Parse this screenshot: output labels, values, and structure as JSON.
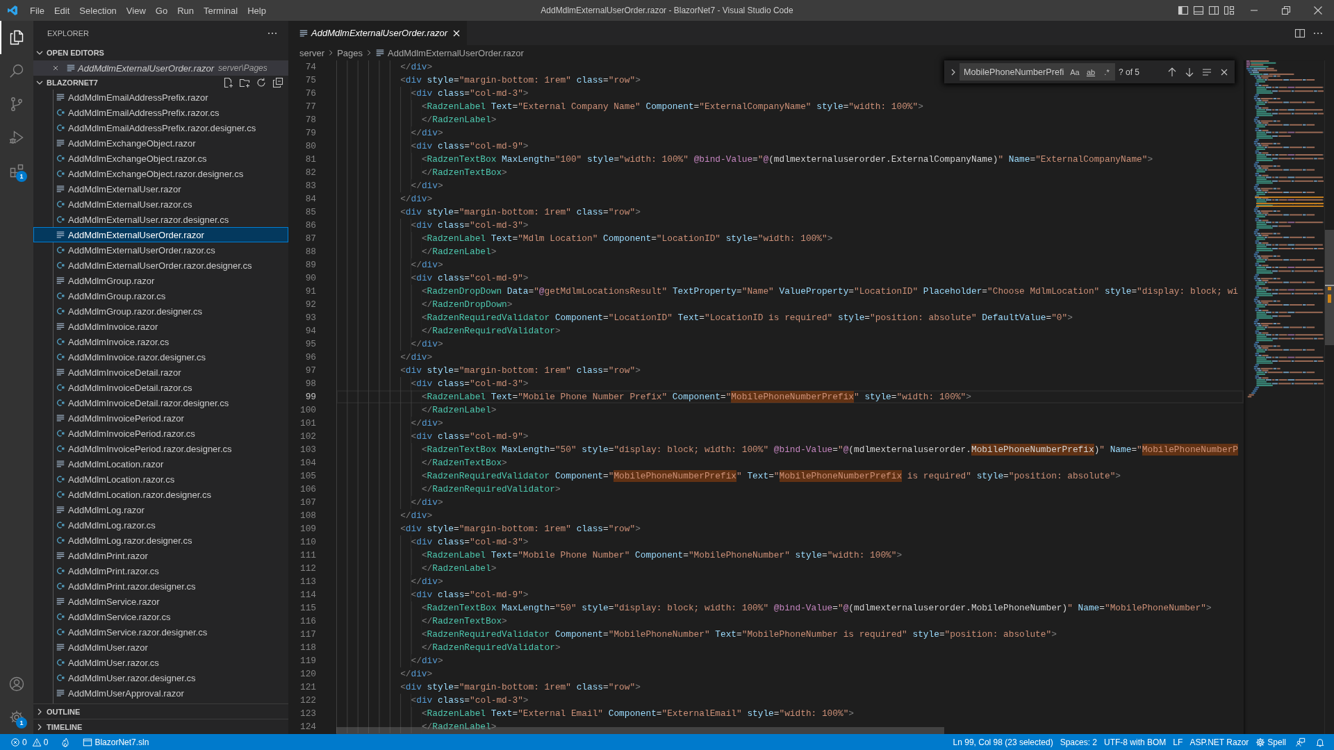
{
  "title_bar": {
    "menus": [
      "File",
      "Edit",
      "Selection",
      "View",
      "Go",
      "Run",
      "Terminal",
      "Help"
    ],
    "title": "AddMdlmExternalUserOrder.razor - BlazorNet7 - Visual Studio Code"
  },
  "activity_bar": {
    "top": [
      {
        "kind": "files",
        "selected": true
      },
      {
        "kind": "search",
        "selected": false
      },
      {
        "kind": "source-control",
        "selected": false
      },
      {
        "kind": "run-debug",
        "selected": false
      },
      {
        "kind": "extensions",
        "selected": false,
        "badge": "1"
      }
    ],
    "bottom": [
      {
        "kind": "account",
        "selected": false
      },
      {
        "kind": "settings",
        "selected": false,
        "badge": "1"
      }
    ]
  },
  "sidebar": {
    "title": "EXPLORER",
    "open_editors": {
      "title": "OPEN EDITORS",
      "expanded": true,
      "items": [
        {
          "name": "AddMdlmExternalUserOrder.razor",
          "description": "server\\Pages",
          "kind": "razor",
          "selected": true,
          "preview": true
        }
      ]
    },
    "folder": {
      "title": "BLAZORNET7",
      "expanded": true,
      "children": [
        {
          "name": "AddMdlmEmailAddressPrefix.razor",
          "kind": "razor",
          "selected": false
        },
        {
          "name": "AddMdlmEmailAddressPrefix.razor.cs",
          "kind": "csharp",
          "selected": false
        },
        {
          "name": "AddMdlmEmailAddressPrefix.razor.designer.cs",
          "kind": "csharp",
          "selected": false
        },
        {
          "name": "AddMdlmExchangeObject.razor",
          "kind": "razor",
          "selected": false
        },
        {
          "name": "AddMdlmExchangeObject.razor.cs",
          "kind": "csharp",
          "selected": false
        },
        {
          "name": "AddMdlmExchangeObject.razor.designer.cs",
          "kind": "csharp",
          "selected": false
        },
        {
          "name": "AddMdlmExternalUser.razor",
          "kind": "razor",
          "selected": false
        },
        {
          "name": "AddMdlmExternalUser.razor.cs",
          "kind": "csharp",
          "selected": false
        },
        {
          "name": "AddMdlmExternalUser.razor.designer.cs",
          "kind": "csharp",
          "selected": false
        },
        {
          "name": "AddMdlmExternalUserOrder.razor",
          "kind": "razor",
          "selected": true
        },
        {
          "name": "AddMdlmExternalUserOrder.razor.cs",
          "kind": "csharp",
          "selected": false
        },
        {
          "name": "AddMdlmExternalUserOrder.razor.designer.cs",
          "kind": "csharp",
          "selected": false
        },
        {
          "name": "AddMdlmGroup.razor",
          "kind": "razor",
          "selected": false
        },
        {
          "name": "AddMdlmGroup.razor.cs",
          "kind": "csharp",
          "selected": false
        },
        {
          "name": "AddMdlmGroup.razor.designer.cs",
          "kind": "csharp",
          "selected": false
        },
        {
          "name": "AddMdlmInvoice.razor",
          "kind": "razor",
          "selected": false
        },
        {
          "name": "AddMdlmInvoice.razor.cs",
          "kind": "csharp",
          "selected": false
        },
        {
          "name": "AddMdlmInvoice.razor.designer.cs",
          "kind": "csharp",
          "selected": false
        },
        {
          "name": "AddMdlmInvoiceDetail.razor",
          "kind": "razor",
          "selected": false
        },
        {
          "name": "AddMdlmInvoiceDetail.razor.cs",
          "kind": "csharp",
          "selected": false
        },
        {
          "name": "AddMdlmInvoiceDetail.razor.designer.cs",
          "kind": "csharp",
          "selected": false
        },
        {
          "name": "AddMdlmInvoicePeriod.razor",
          "kind": "razor",
          "selected": false
        },
        {
          "name": "AddMdlmInvoicePeriod.razor.cs",
          "kind": "csharp",
          "selected": false
        },
        {
          "name": "AddMdlmInvoicePeriod.razor.designer.cs",
          "kind": "csharp",
          "selected": false
        },
        {
          "name": "AddMdlmLocation.razor",
          "kind": "razor",
          "selected": false
        },
        {
          "name": "AddMdlmLocation.razor.cs",
          "kind": "csharp",
          "selected": false
        },
        {
          "name": "AddMdlmLocation.razor.designer.cs",
          "kind": "csharp",
          "selected": false
        },
        {
          "name": "AddMdlmLog.razor",
          "kind": "razor",
          "selected": false
        },
        {
          "name": "AddMdlmLog.razor.cs",
          "kind": "csharp",
          "selected": false
        },
        {
          "name": "AddMdlmLog.razor.designer.cs",
          "kind": "csharp",
          "selected": false
        },
        {
          "name": "AddMdlmPrint.razor",
          "kind": "razor",
          "selected": false
        },
        {
          "name": "AddMdlmPrint.razor.cs",
          "kind": "csharp",
          "selected": false
        },
        {
          "name": "AddMdlmPrint.razor.designer.cs",
          "kind": "csharp",
          "selected": false
        },
        {
          "name": "AddMdlmService.razor",
          "kind": "razor",
          "selected": false
        },
        {
          "name": "AddMdlmService.razor.cs",
          "kind": "csharp",
          "selected": false
        },
        {
          "name": "AddMdlmService.razor.designer.cs",
          "kind": "csharp",
          "selected": false
        },
        {
          "name": "AddMdlmUser.razor",
          "kind": "razor",
          "selected": false
        },
        {
          "name": "AddMdlmUser.razor.cs",
          "kind": "csharp",
          "selected": false
        },
        {
          "name": "AddMdlmUser.razor.designer.cs",
          "kind": "csharp",
          "selected": false
        },
        {
          "name": "AddMdlmUserApproval.razor",
          "kind": "razor",
          "selected": false
        }
      ]
    },
    "outline": {
      "title": "OUTLINE",
      "expanded": false
    },
    "timeline": {
      "title": "TIMELINE",
      "expanded": false
    }
  },
  "editor": {
    "tabs": [
      {
        "label": "AddMdlmExternalUserOrder.razor",
        "kind": "razor",
        "selected": true,
        "preview": true
      }
    ],
    "breadcrumbs": [
      {
        "label": "server",
        "kind": "folder"
      },
      {
        "label": "Pages",
        "kind": "folder"
      },
      {
        "label": "AddMdlmExternalUserOrder.razor",
        "kind": "razor"
      }
    ],
    "find": {
      "expanded": false,
      "query": "MobilePhoneNumberPrefi",
      "options": [
        {
          "kind": "match-case",
          "label": "Aa",
          "on": false
        },
        {
          "kind": "whole-word",
          "label": "ab",
          "on": false
        },
        {
          "kind": "regex",
          "label": ".*",
          "on": false
        }
      ],
      "result": "? of 5"
    },
    "code": {
      "lines": [
        {
          "number": "74",
          "current": false,
          "segments": [
            {
              "text": "            </div>",
              "match": false
            }
          ]
        },
        {
          "number": "75",
          "current": false,
          "segments": [
            {
              "text": "            <div style=\"margin-bottom: 1rem\" class=\"row\">",
              "match": false
            }
          ]
        },
        {
          "number": "76",
          "current": false,
          "segments": [
            {
              "text": "              <div class=\"col-md-3\">",
              "match": false
            }
          ]
        },
        {
          "number": "77",
          "current": false,
          "segments": [
            {
              "text": "                <RadzenLabel Text=\"External Company Name\" Component=\"ExternalCompanyName\" style=\"width: 100%\">",
              "match": false
            }
          ]
        },
        {
          "number": "78",
          "current": false,
          "segments": [
            {
              "text": "                </RadzenLabel>",
              "match": false
            }
          ]
        },
        {
          "number": "79",
          "current": false,
          "segments": [
            {
              "text": "              </div>",
              "match": false
            }
          ]
        },
        {
          "number": "80",
          "current": false,
          "segments": [
            {
              "text": "              <div class=\"col-md-9\">",
              "match": false
            }
          ]
        },
        {
          "number": "81",
          "current": false,
          "segments": [
            {
              "text": "                <RadzenTextBox MaxLength=\"100\" style=\"width: 100%\" @bind-Value=\"@(mdlmexternaluserorder.ExternalCompanyName)\" Name=\"ExternalCompanyName\">",
              "match": false
            }
          ]
        },
        {
          "number": "82",
          "current": false,
          "segments": [
            {
              "text": "                </RadzenTextBox>",
              "match": false
            }
          ]
        },
        {
          "number": "83",
          "current": false,
          "segments": [
            {
              "text": "              </div>",
              "match": false
            }
          ]
        },
        {
          "number": "84",
          "current": false,
          "segments": [
            {
              "text": "            </div>",
              "match": false
            }
          ]
        },
        {
          "number": "85",
          "current": false,
          "segments": [
            {
              "text": "            <div style=\"margin-bottom: 1rem\" class=\"row\">",
              "match": false
            }
          ]
        },
        {
          "number": "86",
          "current": false,
          "segments": [
            {
              "text": "              <div class=\"col-md-3\">",
              "match": false
            }
          ]
        },
        {
          "number": "87",
          "current": false,
          "segments": [
            {
              "text": "                <RadzenLabel Text=\"Mdlm Location\" Component=\"LocationID\" style=\"width: 100%\">",
              "match": false
            }
          ]
        },
        {
          "number": "88",
          "current": false,
          "segments": [
            {
              "text": "                </RadzenLabel>",
              "match": false
            }
          ]
        },
        {
          "number": "89",
          "current": false,
          "segments": [
            {
              "text": "              </div>",
              "match": false
            }
          ]
        },
        {
          "number": "90",
          "current": false,
          "segments": [
            {
              "text": "              <div class=\"col-md-9\">",
              "match": false
            }
          ]
        },
        {
          "number": "91",
          "current": false,
          "segments": [
            {
              "text": "                <RadzenDropDown Data=\"@getMdlmLocationsResult\" TextProperty=\"Name\" ValueProperty=\"LocationID\" Placeholder=\"Choose MdlmLocation\" style=\"display: block; wi",
              "match": false
            }
          ]
        },
        {
          "number": "92",
          "current": false,
          "segments": [
            {
              "text": "                </RadzenDropDown>",
              "match": false
            }
          ]
        },
        {
          "number": "93",
          "current": false,
          "segments": [
            {
              "text": "                <RadzenRequiredValidator Component=\"LocationID\" Text=\"LocationID is required\" style=\"position: absolute\" DefaultValue=\"0\">",
              "match": false
            }
          ]
        },
        {
          "number": "94",
          "current": false,
          "segments": [
            {
              "text": "                </RadzenRequiredValidator>",
              "match": false
            }
          ]
        },
        {
          "number": "95",
          "current": false,
          "segments": [
            {
              "text": "              </div>",
              "match": false
            }
          ]
        },
        {
          "number": "96",
          "current": false,
          "segments": [
            {
              "text": "            </div>",
              "match": false
            }
          ]
        },
        {
          "number": "97",
          "current": false,
          "segments": [
            {
              "text": "            <div style=\"margin-bottom: 1rem\" class=\"row\">",
              "match": false
            }
          ]
        },
        {
          "number": "98",
          "current": false,
          "segments": [
            {
              "text": "              <div class=\"col-md-3\">",
              "match": false
            }
          ]
        },
        {
          "number": "99",
          "current": true,
          "segments": [
            {
              "text": "                <RadzenLabel Text=\"Mobile Phone Number Prefix\" Component=\"",
              "match": false
            },
            {
              "text": "MobilePhoneNumberPrefix",
              "match": true
            },
            {
              "text": "\" style=\"width: 100%\">",
              "match": false
            }
          ]
        },
        {
          "number": "100",
          "current": false,
          "segments": [
            {
              "text": "                </RadzenLabel>",
              "match": false
            }
          ]
        },
        {
          "number": "101",
          "current": false,
          "segments": [
            {
              "text": "              </div>",
              "match": false
            }
          ]
        },
        {
          "number": "102",
          "current": false,
          "segments": [
            {
              "text": "              <div class=\"col-md-9\">",
              "match": false
            }
          ]
        },
        {
          "number": "103",
          "current": false,
          "segments": [
            {
              "text": "                <RadzenTextBox MaxLength=\"50\" style=\"display: block; width: 100%\" @bind-Value=\"@(mdlmexternaluserorder.",
              "match": false
            },
            {
              "text": "MobilePhoneNumberPrefix",
              "match": true
            },
            {
              "text": ")\" Name=\"",
              "match": false
            },
            {
              "text": "MobilePhoneNumberP",
              "match": true
            }
          ]
        },
        {
          "number": "104",
          "current": false,
          "segments": [
            {
              "text": "                </RadzenTextBox>",
              "match": false
            }
          ]
        },
        {
          "number": "105",
          "current": false,
          "segments": [
            {
              "text": "                <RadzenRequiredValidator Component=\"",
              "match": false
            },
            {
              "text": "MobilePhoneNumberPrefix",
              "match": true
            },
            {
              "text": "\" Text=\"",
              "match": false
            },
            {
              "text": "MobilePhoneNumberPrefix",
              "match": true
            },
            {
              "text": " is required\" style=\"position: absolute\">",
              "match": false
            }
          ]
        },
        {
          "number": "106",
          "current": false,
          "segments": [
            {
              "text": "                </RadzenRequiredValidator>",
              "match": false
            }
          ]
        },
        {
          "number": "107",
          "current": false,
          "segments": [
            {
              "text": "              </div>",
              "match": false
            }
          ]
        },
        {
          "number": "108",
          "current": false,
          "segments": [
            {
              "text": "            </div>",
              "match": false
            }
          ]
        },
        {
          "number": "109",
          "current": false,
          "segments": [
            {
              "text": "            <div style=\"margin-bottom: 1rem\" class=\"row\">",
              "match": false
            }
          ]
        },
        {
          "number": "110",
          "current": false,
          "segments": [
            {
              "text": "              <div class=\"col-md-3\">",
              "match": false
            }
          ]
        },
        {
          "number": "111",
          "current": false,
          "segments": [
            {
              "text": "                <RadzenLabel Text=\"Mobile Phone Number\" Component=\"MobilePhoneNumber\" style=\"width: 100%\">",
              "match": false
            }
          ]
        },
        {
          "number": "112",
          "current": false,
          "segments": [
            {
              "text": "                </RadzenLabel>",
              "match": false
            }
          ]
        },
        {
          "number": "113",
          "current": false,
          "segments": [
            {
              "text": "              </div>",
              "match": false
            }
          ]
        },
        {
          "number": "114",
          "current": false,
          "segments": [
            {
              "text": "              <div class=\"col-md-9\">",
              "match": false
            }
          ]
        },
        {
          "number": "115",
          "current": false,
          "segments": [
            {
              "text": "                <RadzenTextBox MaxLength=\"50\" style=\"display: block; width: 100%\" @bind-Value=\"@(mdlmexternaluserorder.MobilePhoneNumber)\" Name=\"MobilePhoneNumber\">",
              "match": false
            }
          ]
        },
        {
          "number": "116",
          "current": false,
          "segments": [
            {
              "text": "                </RadzenTextBox>",
              "match": false
            }
          ]
        },
        {
          "number": "117",
          "current": false,
          "segments": [
            {
              "text": "                <RadzenRequiredValidator Component=\"MobilePhoneNumber\" Text=\"MobilePhoneNumber is required\" style=\"position: absolute\">",
              "match": false
            }
          ]
        },
        {
          "number": "118",
          "current": false,
          "segments": [
            {
              "text": "                </RadzenRequiredValidator>",
              "match": false
            }
          ]
        },
        {
          "number": "119",
          "current": false,
          "segments": [
            {
              "text": "              </div>",
              "match": false
            }
          ]
        },
        {
          "number": "120",
          "current": false,
          "segments": [
            {
              "text": "            </div>",
              "match": false
            }
          ]
        },
        {
          "number": "121",
          "current": false,
          "segments": [
            {
              "text": "            <div style=\"margin-bottom: 1rem\" class=\"row\">",
              "match": false
            }
          ]
        },
        {
          "number": "122",
          "current": false,
          "segments": [
            {
              "text": "              <div class=\"col-md-3\">",
              "match": false
            }
          ]
        },
        {
          "number": "123",
          "current": false,
          "segments": [
            {
              "text": "                <RadzenLabel Text=\"External Email\" Component=\"ExternalEmail\" style=\"width: 100%\">",
              "match": false
            }
          ]
        },
        {
          "number": "124",
          "current": false,
          "segments": [
            {
              "text": "                </RadzenLabel>",
              "match": false
            }
          ]
        }
      ]
    }
  },
  "status_bar": {
    "left": [
      {
        "kind": "problems",
        "errors": "0",
        "warnings": "0"
      },
      {
        "kind": "hot-reload"
      },
      {
        "kind": "solution",
        "label": "BlazorNet7.sln"
      }
    ],
    "right": [
      {
        "kind": "position",
        "label": "Ln 99, Col 98 (23 selected)"
      },
      {
        "kind": "indentation",
        "label": "Spaces: 2"
      },
      {
        "kind": "encoding",
        "label": "UTF-8 with BOM"
      },
      {
        "kind": "eol",
        "label": "LF"
      },
      {
        "kind": "language",
        "label": "ASP.NET Razor"
      },
      {
        "kind": "spell",
        "label": "Spell"
      },
      {
        "kind": "feedback"
      },
      {
        "kind": "notifications"
      }
    ]
  }
}
